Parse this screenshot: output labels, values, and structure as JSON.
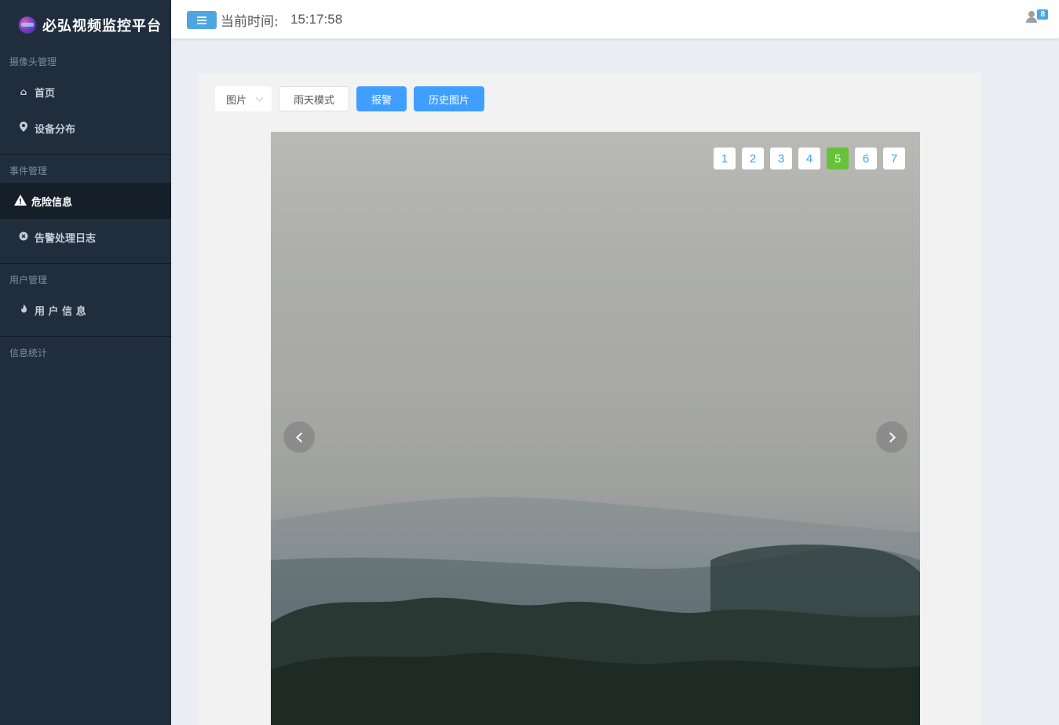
{
  "brand": {
    "title": "必弘视频监控平台"
  },
  "sidebar": {
    "groups": [
      {
        "title": "摄像头管理",
        "items": [
          {
            "label": "首页",
            "icon": "home-icon"
          },
          {
            "label": "设备分布",
            "icon": "map-marker-icon"
          }
        ]
      },
      {
        "title": "事件管理",
        "items": [
          {
            "label": "危险信息",
            "icon": "warning-icon",
            "active": true
          },
          {
            "label": "告警处理日志",
            "icon": "log-icon"
          }
        ]
      },
      {
        "title": "用户管理",
        "items": [
          {
            "label": "用 户 信 息",
            "icon": "fire-icon"
          }
        ]
      },
      {
        "title": "信息统计",
        "items": []
      }
    ]
  },
  "header": {
    "time_label": "当前时间:",
    "time_value": "15:17:58",
    "notification_count": "8"
  },
  "toolbar": {
    "select_value": "图片",
    "rain_mode_label": "雨天模式",
    "alarm_label": "报警",
    "history_label": "历史图片"
  },
  "carousel": {
    "pages": [
      "1",
      "2",
      "3",
      "4",
      "5",
      "6",
      "7"
    ],
    "active_page": "5"
  },
  "colors": {
    "sidebar_bg": "#1f2d3d",
    "primary": "#409eff",
    "active_page": "#67c23a"
  }
}
